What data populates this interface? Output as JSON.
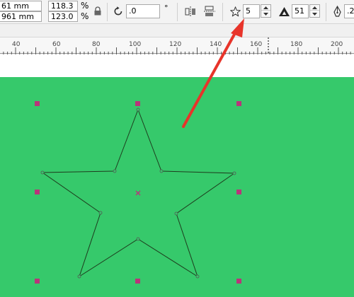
{
  "size": {
    "width_value": "61 mm",
    "height_value": "961 mm",
    "scale_x": "118.3",
    "scale_y": "123.0",
    "percent_sign": "%"
  },
  "rotation": {
    "value": ".0",
    "unit": "°"
  },
  "star": {
    "points_value": "5",
    "sharpness_value": "51"
  },
  "outline": {
    "width_value": ".2"
  },
  "ruler": {
    "labels": [
      "40",
      "60",
      "80",
      "100",
      "120",
      "140",
      "160",
      "180",
      "200"
    ]
  },
  "colors": {
    "page_fill": "#36c96b",
    "handle": "#b8357a",
    "annotation_arrow": "#e8342a"
  }
}
